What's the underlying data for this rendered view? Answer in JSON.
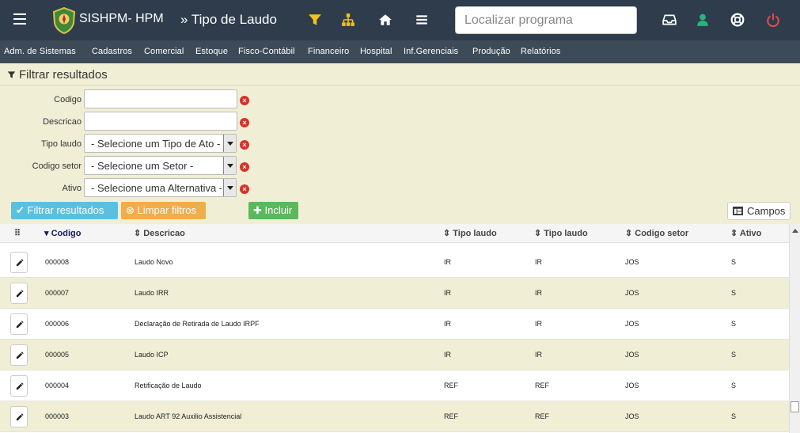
{
  "app": {
    "brand": "SISHPM- HPM",
    "page_title": "» Tipo de Laudo",
    "search_placeholder": "Localizar programa"
  },
  "icons": {
    "menu": "hamburger-icon",
    "filter": "filter-icon",
    "sitemap": "sitemap-icon",
    "home": "home-icon",
    "list": "list-icon",
    "inbox": "inbox-icon",
    "user": "user-icon",
    "help": "lifebuoy-icon",
    "power": "power-icon"
  },
  "colors": {
    "navbar": "#2e3c4c",
    "menubar": "#3d4a57",
    "panel": "#f0efd6",
    "filter_icon": "#f0c419",
    "sitemap_icon": "#f0c419",
    "user_icon": "#2ab27b",
    "power_icon": "#e04b4b",
    "btn_blue": "#5bc0de",
    "btn_orange": "#f0ad4e",
    "btn_green": "#5cb85c"
  },
  "menu": [
    "Adm. de Sistemas",
    "Cadastros",
    "Comercial",
    "Estoque",
    "Fisco-Contábil",
    "Financeiro",
    "Hospital",
    "Inf.Gerenciais",
    "Produção",
    "Relatórios"
  ],
  "filter": {
    "title": "Filtrar resultados",
    "fields": [
      {
        "label": "Codigo",
        "value": ""
      },
      {
        "label": "Descricao",
        "value": ""
      },
      {
        "label": "Tipo laudo",
        "value": "- Selecione um Tipo de Ato -"
      },
      {
        "label": "Codigo setor",
        "value": "- Selecione um Setor -"
      },
      {
        "label": "Ativo",
        "value": "- Selecione uma Alternativa -"
      }
    ],
    "clear_glyph": "×"
  },
  "buttons": {
    "filtrar": "Filtrar resultados",
    "limpar": "Limpar filtros",
    "incluir": "Incluir",
    "campos": "Campos"
  },
  "grid": {
    "columns": [
      "Codigo",
      "Descricao",
      "Tipo laudo",
      "Tipo laudo",
      "Codigo setor",
      "Ativo"
    ],
    "sorted_column": "Codigo",
    "rows": [
      {
        "codigo": "000008",
        "descricao": "Laudo Novo",
        "tipo1": "IR",
        "tipo2": "IR",
        "setor": "JOS",
        "ativo": "S"
      },
      {
        "codigo": "000007",
        "descricao": "Laudo IRR",
        "tipo1": "IR",
        "tipo2": "IR",
        "setor": "JOS",
        "ativo": "S"
      },
      {
        "codigo": "000006",
        "descricao": "Declaração de Retirada de Laudo IRPF",
        "tipo1": "IR",
        "tipo2": "IR",
        "setor": "JOS",
        "ativo": "S"
      },
      {
        "codigo": "000005",
        "descricao": "Laudo ICP",
        "tipo1": "IR",
        "tipo2": "IR",
        "setor": "JOS",
        "ativo": "S"
      },
      {
        "codigo": "000004",
        "descricao": "Retificação de Laudo",
        "tipo1": "REF",
        "tipo2": "REF",
        "setor": "JOS",
        "ativo": "S"
      },
      {
        "codigo": "000003",
        "descricao": "Laudo ART 92 Auxilio Assistencial",
        "tipo1": "REF",
        "tipo2": "REF",
        "setor": "JOS",
        "ativo": "S"
      }
    ]
  }
}
